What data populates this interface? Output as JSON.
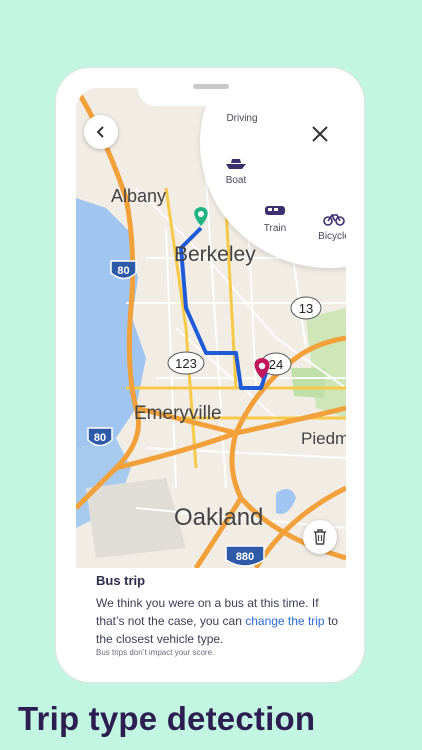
{
  "modes": [
    {
      "label": "Driving",
      "icon": "car-icon"
    },
    {
      "label": "Boat",
      "icon": "boat-icon"
    },
    {
      "label": "Train",
      "icon": "train-icon"
    },
    {
      "label": "Bicycle",
      "icon": "bicycle-icon"
    }
  ],
  "map": {
    "places": [
      "Albany",
      "Berkeley",
      "Emeryville",
      "Oakland",
      "Piedm"
    ],
    "shields": [
      "80",
      "13",
      "123",
      "24",
      "80",
      "880"
    ]
  },
  "card": {
    "title": "Bus trip",
    "body_pre": "We think you were on a bus at this time. If that’s not the case, you can ",
    "link": "change the trip",
    "body_post": " to the closest vehicle type.",
    "footnote": "Bus trips don’t impact your score."
  },
  "headline": "Trip type detection",
  "colors": {
    "background": "#c3f5e3",
    "route": "#1f5bd6",
    "start_pin": "#20b582",
    "end_pin": "#c2185b",
    "headline": "#2d1e52"
  }
}
